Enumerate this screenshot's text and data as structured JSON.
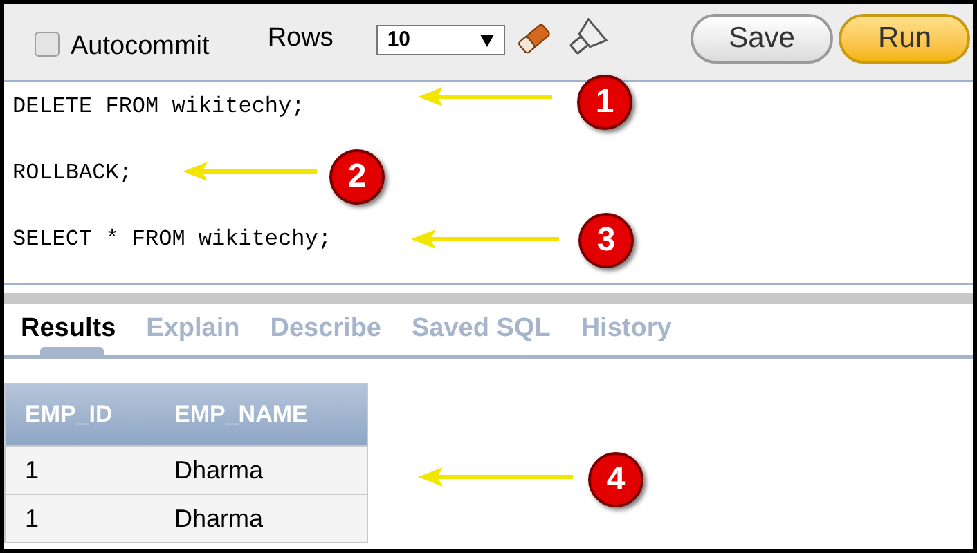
{
  "toolbar": {
    "autocommit": {
      "label": "Autocommit",
      "checked": false
    },
    "rows_label": "Rows",
    "rows_value": "10",
    "buttons": [
      {
        "label": "Save",
        "kind": "default"
      },
      {
        "label": "Run",
        "kind": "primary"
      }
    ]
  },
  "editor": {
    "lines": [
      "DELETE FROM wikitechy;",
      "ROLLBACK;",
      "SELECT * FROM wikitechy;"
    ]
  },
  "tabs": [
    {
      "label": "Results",
      "selected": true
    },
    {
      "label": "Explain",
      "selected": false
    },
    {
      "label": "Describe",
      "selected": false
    },
    {
      "label": "Saved SQL",
      "selected": false
    },
    {
      "label": "History",
      "selected": false
    }
  ],
  "table": {
    "columns": [
      "EMP_ID",
      "EMP_NAME"
    ],
    "rows": [
      [
        "1",
        "Dharma"
      ],
      [
        "1",
        "Dharma"
      ]
    ]
  },
  "callouts": [
    {
      "label": "1"
    },
    {
      "label": "2"
    },
    {
      "label": "3"
    },
    {
      "label": "4"
    }
  ]
}
